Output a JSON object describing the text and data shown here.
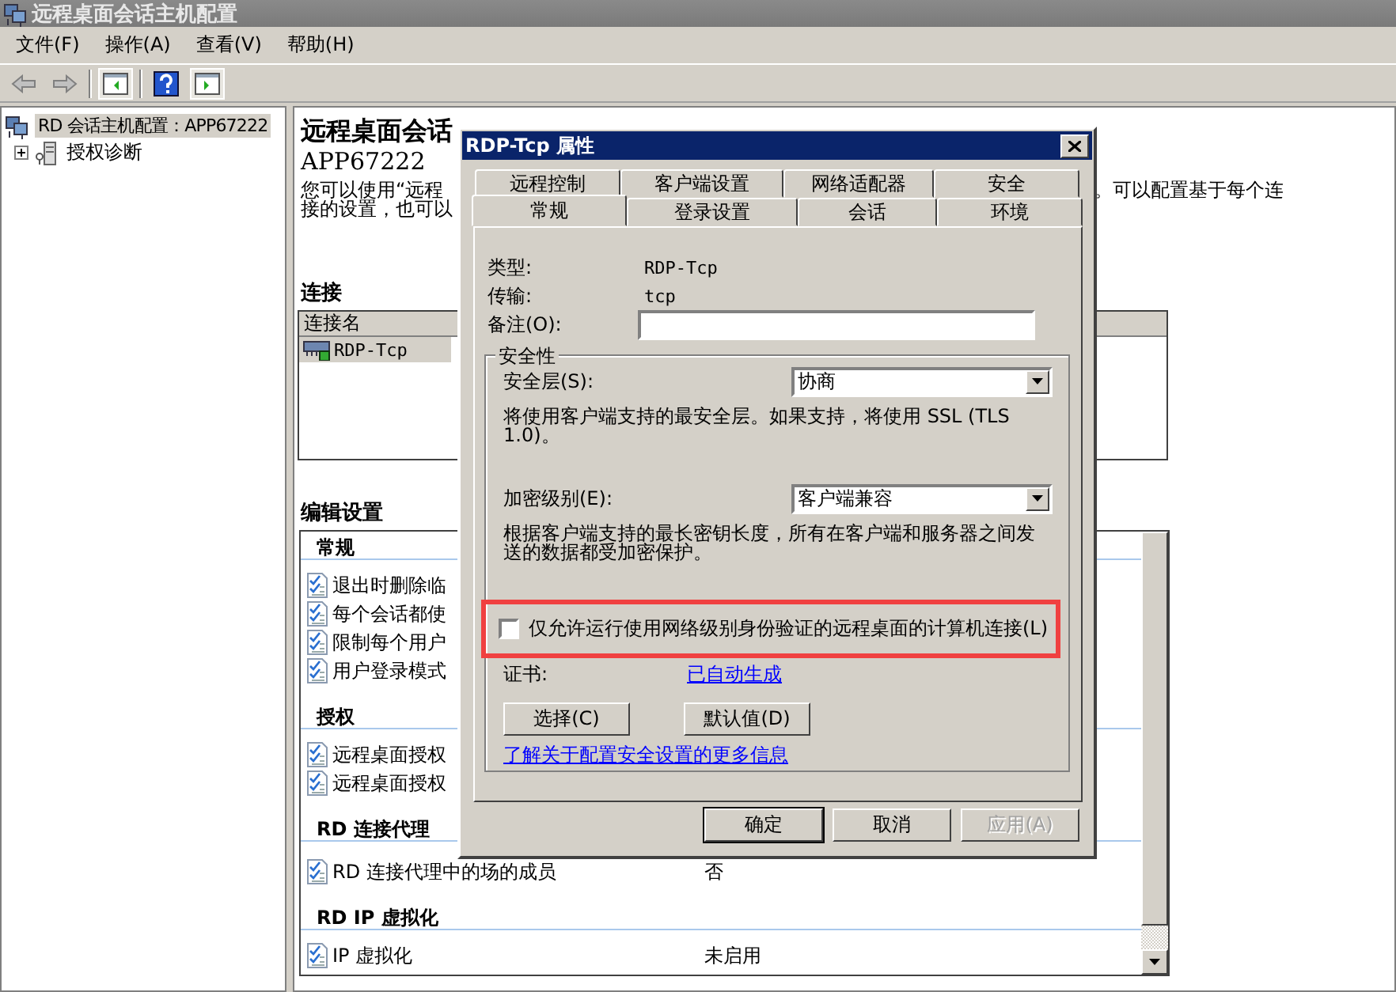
{
  "window": {
    "title": "远程桌面会话主机配置"
  },
  "menu": [
    "文件(F)",
    "操作(A)",
    "查看(V)",
    "帮助(H)"
  ],
  "tree": {
    "root": {
      "label": "RD 会话主机配置：APP67222",
      "selected": true
    },
    "children": [
      {
        "label": "授权诊断",
        "expanded": false
      }
    ]
  },
  "main": {
    "heading": "远程桌面会话",
    "server": "APP67222",
    "description": [
      {
        "left": "您可以使用“远程",
        "right": "。可以配置基于每个连"
      },
      {
        "left": "接的设置，也可以"
      }
    ],
    "connections": {
      "title": "连接",
      "columns": [
        "连接名"
      ],
      "rows": [
        {
          "name": "RDP-Tcp",
          "selected": true
        }
      ]
    },
    "settings": {
      "title": "编辑设置",
      "groups": [
        {
          "title": "常规",
          "items": [
            {
              "label": "退出时删除临"
            },
            {
              "label": "每个会话都使"
            },
            {
              "label": "限制每个用户"
            },
            {
              "label": "用户登录模式"
            }
          ]
        },
        {
          "title": "授权",
          "items": [
            {
              "label": "远程桌面授权"
            },
            {
              "label": "远程桌面授权"
            }
          ]
        },
        {
          "title": "RD 连接代理",
          "items": [
            {
              "label": "RD 连接代理中的场的成员",
              "value": "否"
            }
          ]
        },
        {
          "title": "RD IP 虚拟化",
          "items": [
            {
              "label": "IP 虚拟化",
              "value": "未启用"
            }
          ]
        }
      ]
    }
  },
  "dialog": {
    "title": "RDP-Tcp 属性",
    "tab_rows": [
      {
        "tabs": [
          {
            "label": "远程控制",
            "selected": false
          },
          {
            "label": "客户端设置",
            "selected": false
          },
          {
            "label": "网络适配器",
            "selected": false
          },
          {
            "label": "安全",
            "selected": false
          }
        ]
      },
      {
        "tabs": [
          {
            "label": "常规",
            "selected": true
          },
          {
            "label": "登录设置",
            "selected": false
          },
          {
            "label": "会话",
            "selected": false
          },
          {
            "label": "环境",
            "selected": false
          }
        ]
      }
    ],
    "type": {
      "label": "类型:",
      "value": "RDP-Tcp"
    },
    "transport": {
      "label": "传输:",
      "value": "tcp"
    },
    "comment": {
      "label": "备注(O):"
    },
    "security": {
      "title": "安全性",
      "layer": {
        "label": "安全层(S):",
        "value": "协商",
        "note": "将使用客户端支持的最安全层。如果支持，将使用 SSL (TLS 1.0)。"
      },
      "encryption": {
        "label": "加密级别(E):",
        "value": "客户端兼容",
        "note": "根据客户端支持的最长密钥长度，所有在客户端和服务器之间发送的数据都受加密保护。"
      },
      "nla": {
        "label": "仅允许运行使用网络级别身份验证的远程桌面的计算机连接(L)",
        "checked": false,
        "highlighted": true
      },
      "certificate": {
        "label": "证书:",
        "link": "已自动生成"
      },
      "buttons": [
        "选择(C)",
        "默认值(D)"
      ],
      "help_link": "了解关于配置安全设置的更多信息"
    },
    "buttons": [
      {
        "label": "确定",
        "default": true,
        "disabled": false
      },
      {
        "label": "取消",
        "default": false,
        "disabled": false
      },
      {
        "label": "应用(A)",
        "default": false,
        "disabled": true
      }
    ]
  }
}
